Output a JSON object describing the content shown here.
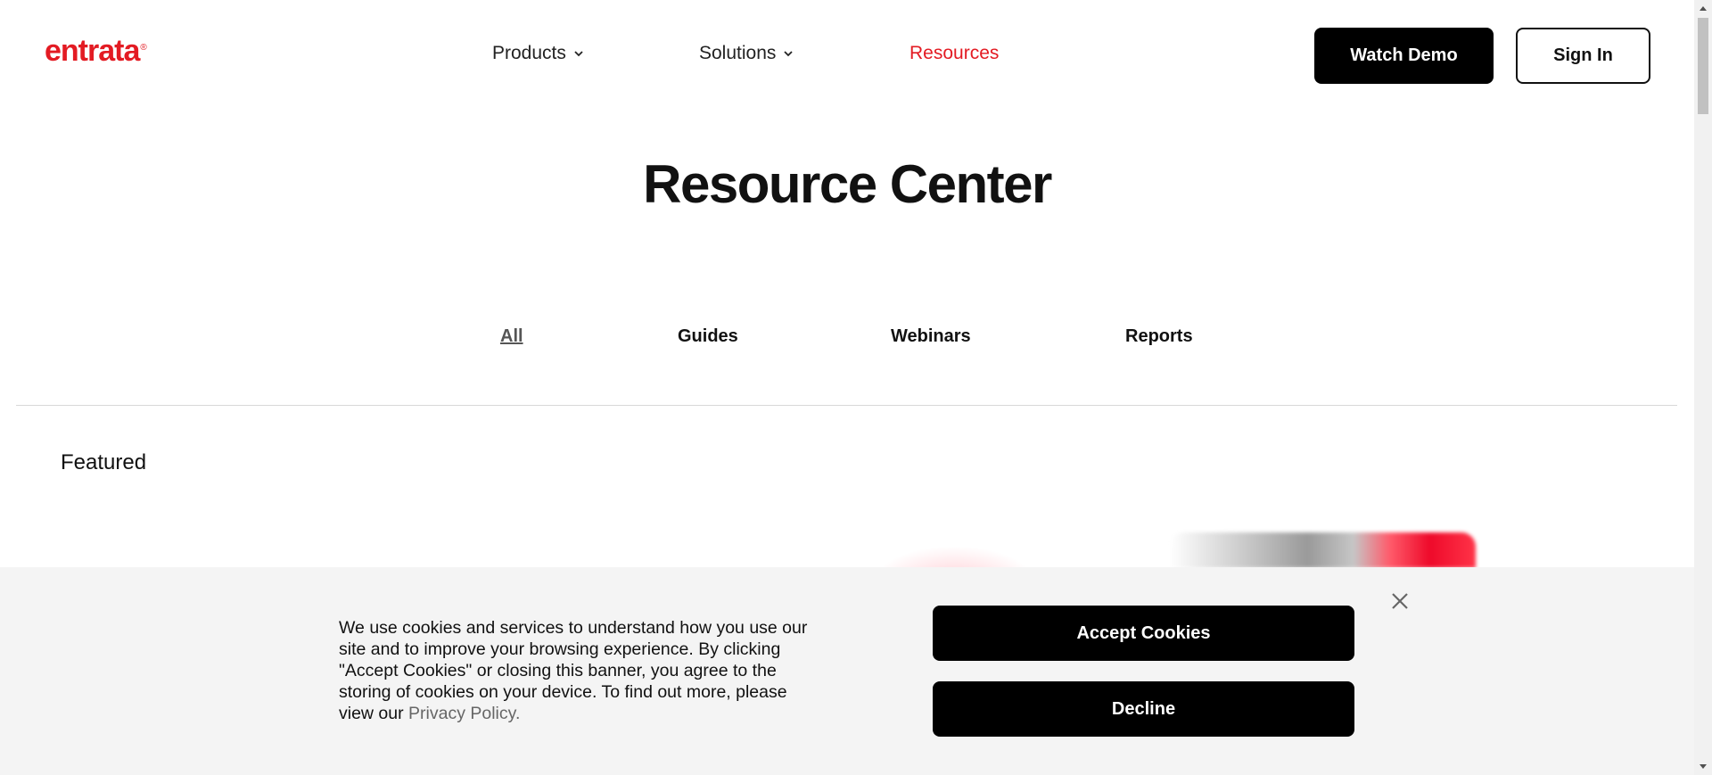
{
  "header": {
    "logo_text": "entrata",
    "logo_mark": "®",
    "nav": [
      {
        "label": "Products",
        "icon": "chevron-down-icon"
      },
      {
        "label": "Solutions",
        "icon": "chevron-down-icon"
      },
      {
        "label": "Resources"
      }
    ],
    "watch_demo_label": "Watch Demo",
    "sign_in_label": "Sign In"
  },
  "main": {
    "title": "Resource Center",
    "tabs": [
      {
        "label": "All",
        "active": true
      },
      {
        "label": "Guides"
      },
      {
        "label": "Webinars"
      },
      {
        "label": "Reports"
      }
    ],
    "featured_label": "Featured"
  },
  "cookie_banner": {
    "text": "We use cookies and services to understand how you use our site and to improve your browsing experience. By clicking \"Accept Cookies\" or closing this banner, you agree to the storing of cookies on your device. To find out more, please view our ",
    "privacy_link": "Privacy Policy.",
    "accept_label": "Accept Cookies",
    "decline_label": "Decline",
    "close_icon": "close-icon"
  },
  "colors": {
    "brand": "#e31b23",
    "button_dark": "#000000",
    "banner_bg": "#f4f4f4"
  }
}
